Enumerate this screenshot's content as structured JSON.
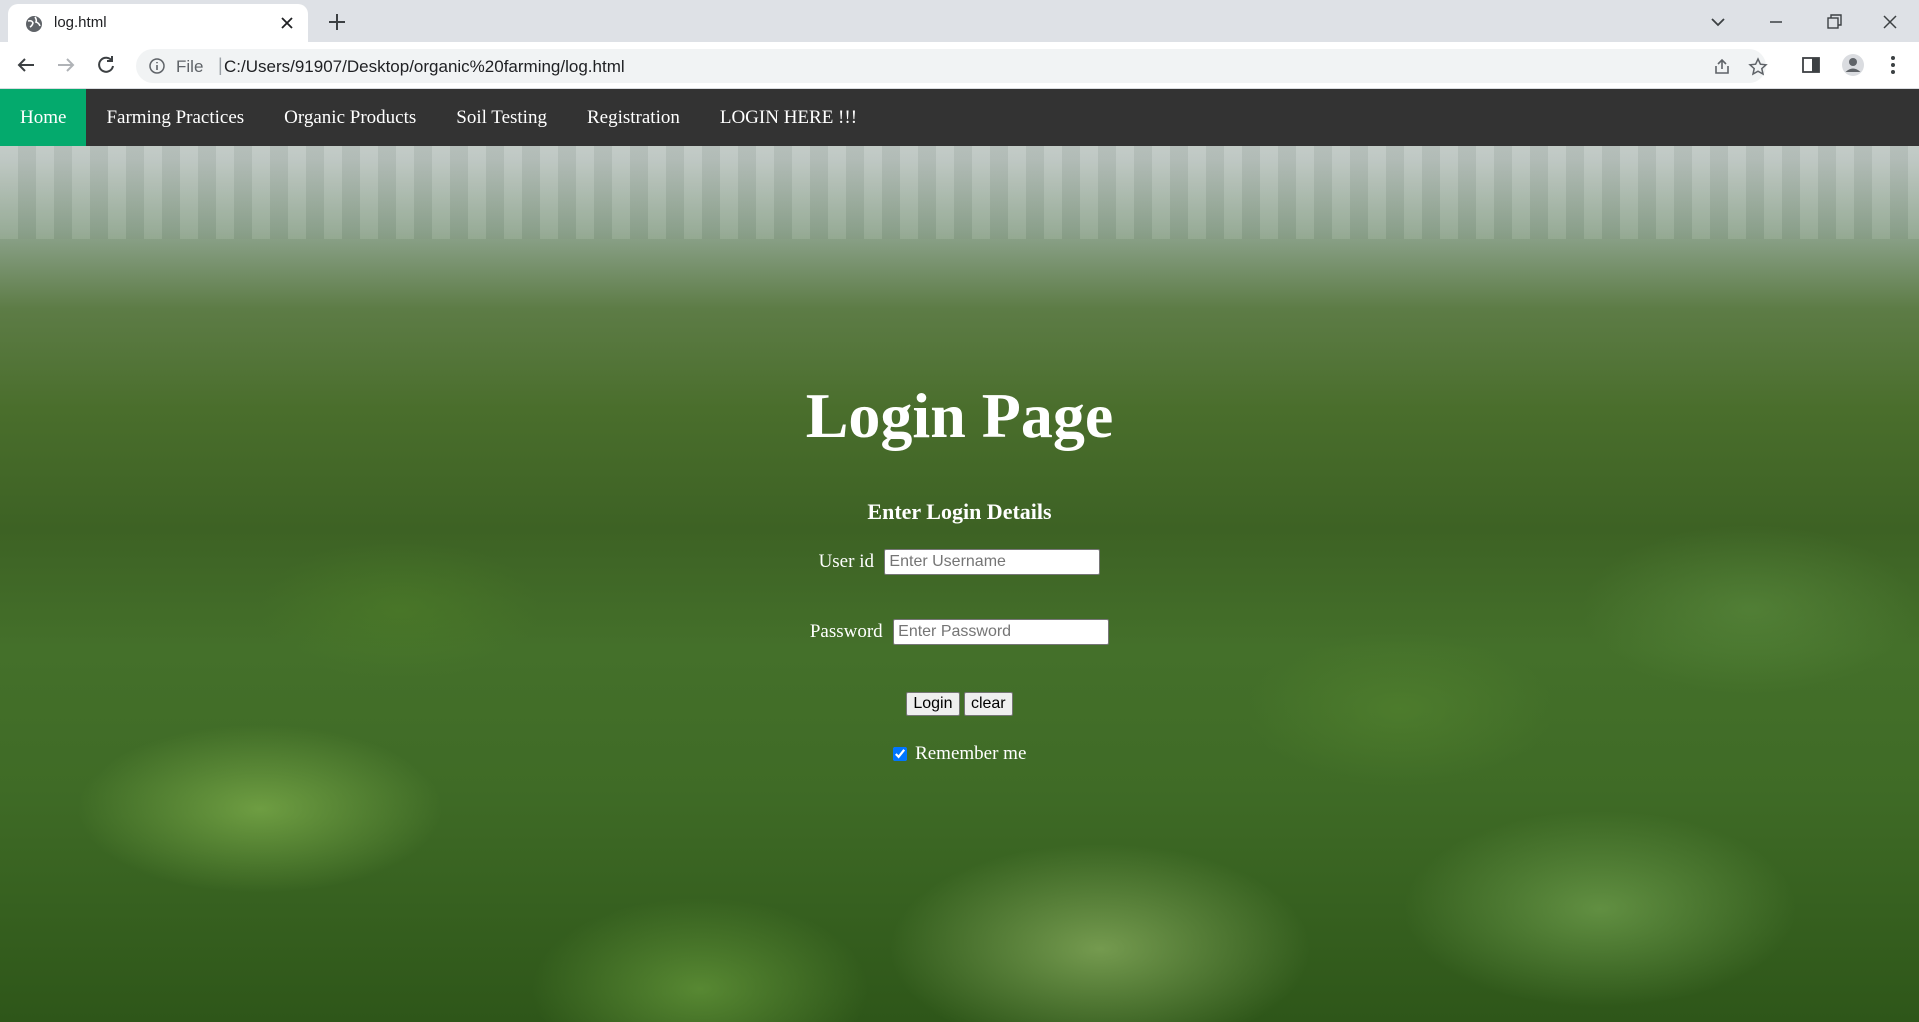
{
  "browser": {
    "tab_title": "log.html",
    "scheme_label": "File",
    "url": "C:/Users/91907/Desktop/organic%20farming/log.html"
  },
  "nav": {
    "items": [
      {
        "label": "Home",
        "active": true
      },
      {
        "label": "Farming Practices",
        "active": false
      },
      {
        "label": "Organic Products",
        "active": false
      },
      {
        "label": "Soil Testing",
        "active": false
      },
      {
        "label": "Registration",
        "active": false
      },
      {
        "label": "LOGIN HERE !!!",
        "active": false
      }
    ],
    "active_color": "#04aa6d",
    "bar_color": "#333333"
  },
  "login": {
    "title": "Login Page",
    "subtitle": "Enter Login Details",
    "userid_label": "User id",
    "userid_placeholder": "Enter Username",
    "password_label": "Password",
    "password_placeholder": "Enter Password",
    "login_button": "Login",
    "clear_button": "clear",
    "remember_label": "Remember me",
    "remember_checked": true
  }
}
